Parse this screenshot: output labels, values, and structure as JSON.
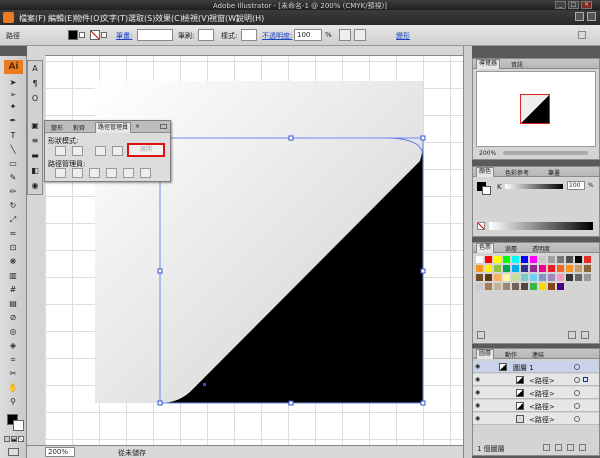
{
  "title_bar": {
    "title": "Adobe Illustrator - [未命名-1 @ 200% (CMYK/預視)]",
    "minimize": "_",
    "maximize": "□",
    "close": "×"
  },
  "menu_bar": {
    "items": [
      "檔案(F)",
      "編輯(E)",
      "物件(O)",
      "文字(T)",
      "選取(S)",
      "效果(C)",
      "檢視(V)",
      "視窗(W)",
      "說明(H)"
    ]
  },
  "control_bar": {
    "selection_label": "路徑",
    "stroke_label": "筆畫:",
    "brush_label": "筆刷:",
    "style_label": "樣式:",
    "opacity_label": "不透明度:",
    "opacity_value": "100",
    "opacity_unit": "%",
    "transform_label": "變形"
  },
  "toolbox": {
    "logo": "Ai"
  },
  "pathfinder_panel": {
    "tabs": [
      "變形",
      "對齊",
      "路徑管理員"
    ],
    "close": "×",
    "shape_modes_label": "形狀模式:",
    "expand_button": "展開",
    "pathfinders_label": "路徑管理員:"
  },
  "navigator_panel": {
    "tabs": [
      "導覽器",
      "資訊"
    ],
    "zoom": "200%"
  },
  "color_panel": {
    "tabs": [
      "顏色",
      "色彩參考",
      "筆畫"
    ],
    "k_label": "K",
    "k_value": "100",
    "k_unit": "%"
  },
  "swatches_panel": {
    "tabs": [
      "色票",
      "漸層",
      "透明度"
    ],
    "colors": [
      "#ffffff",
      "#ff0000",
      "#ffff00",
      "#00ff00",
      "#00ffff",
      "#0000ff",
      "#ff00ff",
      "#c8c8c8",
      "#a0a0a0",
      "#787878",
      "#505050",
      "#000000",
      "#e62e25",
      "#f7941d",
      "#fff200",
      "#8dc63f",
      "#00a651",
      "#00aeef",
      "#2e3192",
      "#92278f",
      "#ec008c",
      "#ed1c24",
      "#f26522",
      "#f7941d",
      "#c69c6d",
      "#8c6239",
      "#754c24",
      "#603913",
      "#fbaf5d",
      "#fff799",
      "#c4df9b",
      "#7accc8",
      "#6dcff6",
      "#8393ca",
      "#a187be",
      "#f49ac1",
      "#333333",
      "#666666",
      "#999999",
      "#cccccc",
      "#a67c52",
      "#c7b299",
      "#998675",
      "#736357",
      "#534741",
      "#39b54a",
      "#ffd700",
      "#8b4513",
      "#4b0082"
    ]
  },
  "layers_panel": {
    "tabs": [
      "圖層",
      "動作",
      "連結"
    ],
    "layer_name": "圖層 1",
    "rows": [
      {
        "label": "<路徑>"
      },
      {
        "label": "<路徑>"
      },
      {
        "label": "<路徑>"
      },
      {
        "label": "<路徑>"
      }
    ],
    "footer": "1 個圖層"
  },
  "status_bar": {
    "zoom": "200%",
    "status": "從未儲存"
  }
}
